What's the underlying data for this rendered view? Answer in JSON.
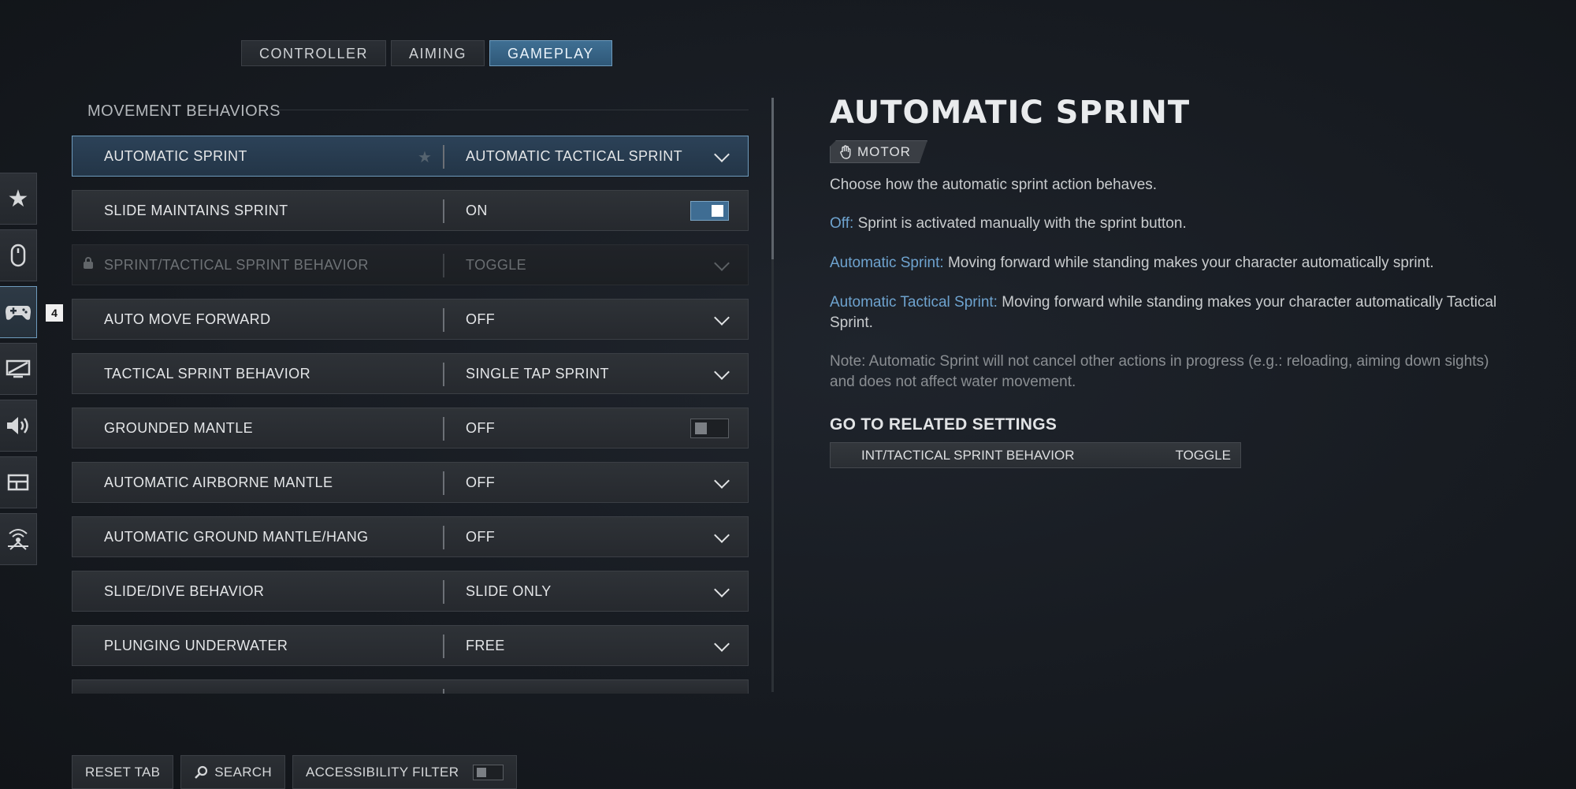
{
  "tabs": [
    {
      "label": "CONTROLLER",
      "active": false
    },
    {
      "label": "AIMING",
      "active": false
    },
    {
      "label": "GAMEPLAY",
      "active": true
    }
  ],
  "rail": {
    "icons": [
      "star-icon",
      "mouse-icon",
      "gamepad-icon",
      "display-icon",
      "speaker-icon",
      "layout-icon",
      "network-icon"
    ],
    "active_index": 2,
    "badge": "4"
  },
  "section": {
    "title": "MOVEMENT BEHAVIORS"
  },
  "settings": [
    {
      "label": "AUTOMATIC SPRINT",
      "value": "AUTOMATIC TACTICAL SPRINT"
    },
    {
      "label": "SLIDE MAINTAINS SPRINT",
      "value": "ON"
    },
    {
      "label": "SPRINT/TACTICAL SPRINT BEHAVIOR",
      "value": "TOGGLE"
    },
    {
      "label": "AUTO MOVE FORWARD",
      "value": "OFF"
    },
    {
      "label": "TACTICAL SPRINT BEHAVIOR",
      "value": "SINGLE TAP SPRINT"
    },
    {
      "label": "GROUNDED MANTLE",
      "value": "OFF"
    },
    {
      "label": "AUTOMATIC AIRBORNE MANTLE",
      "value": "OFF"
    },
    {
      "label": "AUTOMATIC GROUND MANTLE/HANG",
      "value": "OFF"
    },
    {
      "label": "SLIDE/DIVE BEHAVIOR",
      "value": "SLIDE ONLY"
    },
    {
      "label": "PLUNGING UNDERWATER",
      "value": "FREE"
    }
  ],
  "detail": {
    "title": "AUTOMATIC SPRINT",
    "tag": "MOTOR",
    "intro": "Choose how the automatic sprint action behaves.",
    "options": [
      {
        "name": "Off:",
        "text": "Sprint is activated manually with the sprint button."
      },
      {
        "name": "Automatic Sprint:",
        "text": "Moving forward while standing makes your character automatically sprint."
      },
      {
        "name": "Automatic Tactical Sprint:",
        "text": "Moving forward while standing makes your character automatically Tactical Sprint."
      }
    ],
    "note": "Note: Automatic Sprint will not cancel other actions in progress (e.g.: reloading, aiming down sights) and does not affect water movement.",
    "related_title": "GO TO RELATED SETTINGS",
    "related_label": "INT/TACTICAL SPRINT BEHAVIOR",
    "related_value": "TOGGLE"
  },
  "bottom": {
    "reset": "RESET TAB",
    "search": "SEARCH",
    "filter": "ACCESSIBILITY FILTER"
  },
  "colors": {
    "accent": "#6ea3cf",
    "selected_border": "#6e9bbd",
    "toggle_on": "#3f6d93"
  }
}
